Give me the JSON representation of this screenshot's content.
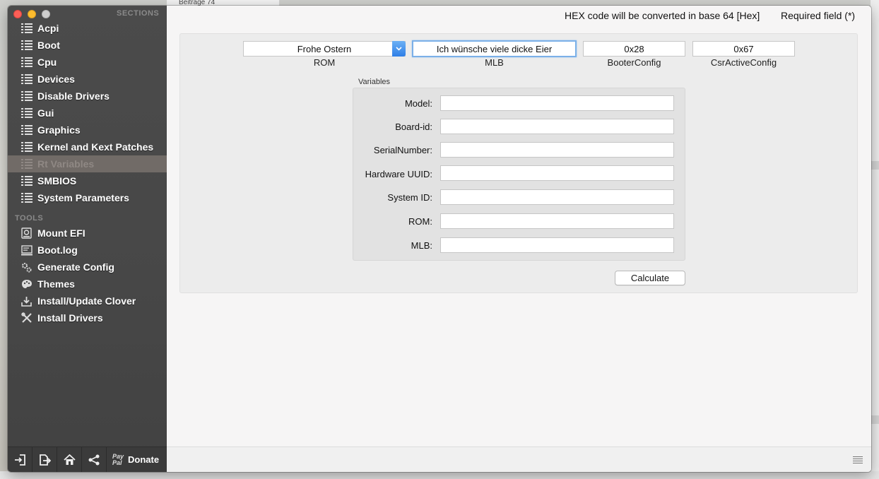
{
  "background": {
    "top_text": "Beiträge 74"
  },
  "sidebar": {
    "sections_heading": "SECTIONS",
    "sections": [
      {
        "label": "Acpi",
        "icon": "list-icon"
      },
      {
        "label": "Boot",
        "icon": "list-icon"
      },
      {
        "label": "Cpu",
        "icon": "list-icon"
      },
      {
        "label": "Devices",
        "icon": "list-icon"
      },
      {
        "label": "Disable Drivers",
        "icon": "list-icon"
      },
      {
        "label": "Gui",
        "icon": "list-icon"
      },
      {
        "label": "Graphics",
        "icon": "list-icon"
      },
      {
        "label": "Kernel and Kext Patches",
        "icon": "list-icon"
      },
      {
        "label": "Rt Variables",
        "icon": "list-icon",
        "selected": true
      },
      {
        "label": "SMBIOS",
        "icon": "list-icon"
      },
      {
        "label": "System Parameters",
        "icon": "list-icon"
      }
    ],
    "tools_heading": "TOOLS",
    "tools": [
      {
        "label": "Mount EFI",
        "icon": "disk-icon"
      },
      {
        "label": "Boot.log",
        "icon": "log-icon"
      },
      {
        "label": "Generate Config",
        "icon": "gear-icon"
      },
      {
        "label": "Themes",
        "icon": "palette-icon"
      },
      {
        "label": "Install/Update Clover",
        "icon": "download-icon"
      },
      {
        "label": "Install Drivers",
        "icon": "wrench-icon"
      }
    ],
    "footer": {
      "donate_label": "Donate",
      "paypal_line1": "Pay",
      "paypal_line2": "Pal"
    }
  },
  "header": {
    "hex_note": "HEX code will be converted in base 64 [Hex]",
    "required_note": "Required field (*)"
  },
  "top_fields": {
    "rom_value": "Frohe Ostern",
    "rom_label": "ROM",
    "mlb_value": "Ich wünsche viele dicke Eier",
    "mlb_label": "MLB",
    "booter_value": "0x28",
    "booter_label": "BooterConfig",
    "csr_value": "0x67",
    "csr_label": "CsrActiveConfig"
  },
  "variables": {
    "title": "Variables",
    "rows": [
      {
        "label": "Model:",
        "value": ""
      },
      {
        "label": "Board-id:",
        "value": ""
      },
      {
        "label": "SerialNumber:",
        "value": ""
      },
      {
        "label": "Hardware UUID:",
        "value": ""
      },
      {
        "label": "System ID:",
        "value": ""
      },
      {
        "label": "ROM:",
        "value": ""
      },
      {
        "label": "MLB:",
        "value": ""
      }
    ],
    "calculate_label": "Calculate"
  },
  "colors": {
    "sidebar_bg": "#474747",
    "selected_bg": "#716b67",
    "accent_blue": "#2f7fe6"
  }
}
